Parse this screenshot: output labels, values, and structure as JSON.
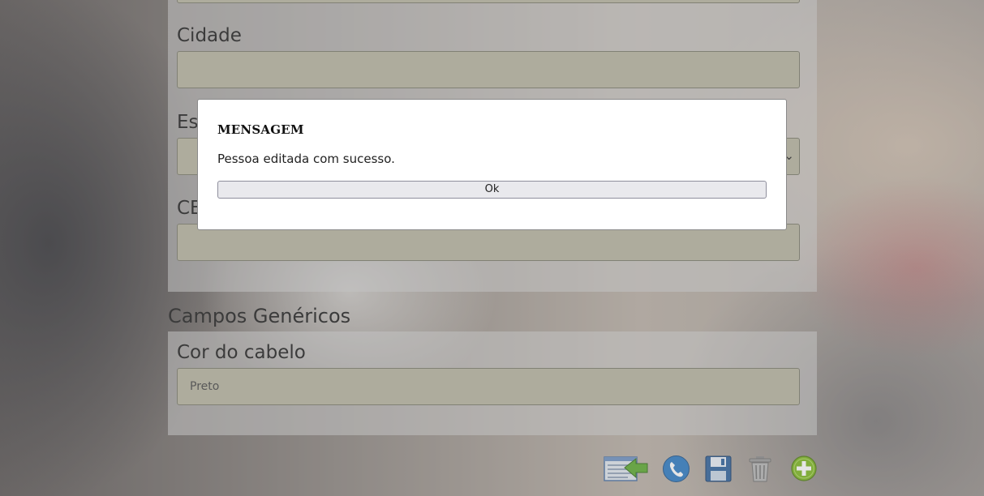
{
  "form": {
    "city_label": "Cidade",
    "state_label_partial": "Es",
    "cep_label_partial": "CE",
    "generic_section_title": "Campos Genéricos",
    "hair_color_label": "Cor do cabelo",
    "hair_color_value": "Preto"
  },
  "dialog": {
    "title": "MENSAGEM",
    "message": "Pessoa editada com sucesso.",
    "ok_label": "Ok"
  },
  "toolbar": {
    "icons": [
      "back-to-list-icon",
      "phone-icon",
      "save-icon",
      "trash-icon",
      "add-icon"
    ]
  },
  "colors": {
    "field_background": "#b6b39f",
    "add_icon_green": "#7ab51d",
    "phone_icon_blue": "#2a78c2",
    "save_icon_blue": "#2d5f9a"
  }
}
